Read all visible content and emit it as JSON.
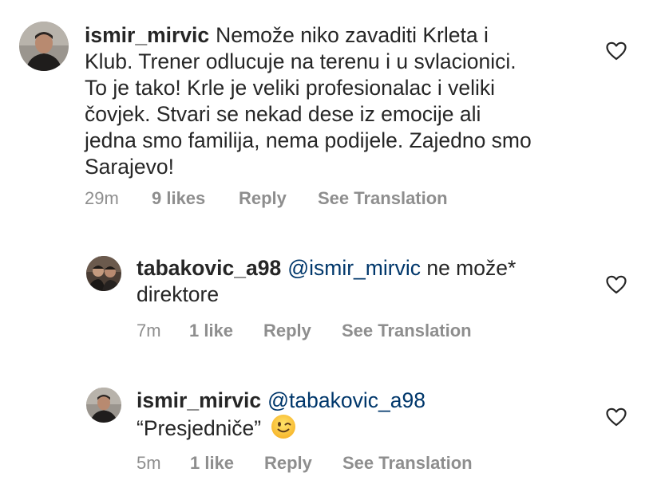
{
  "comments": [
    {
      "username": "ismir_mirvic",
      "text_lines": [
        "Nemože niko zavaditi Krleta i",
        "Klub. Trener odlucuje na terenu i u svlacionici.",
        "To je tako! Krle je veliki profesionalac i veliki",
        "čovjek. Stvari se nekad dese iz emocije ali",
        "jedna smo familija, nema podijele. Zajedno smo",
        "Sarajevo!"
      ],
      "time": "29m",
      "likes": "9 likes",
      "reply": "Reply",
      "translate": "See Translation",
      "avatar": "man-portrait-avatar"
    },
    {
      "username": "tabakovic_a98",
      "mention": "@ismir_mirvic",
      "text_first": "ne može*",
      "text_second": "direktore",
      "time": "7m",
      "likes": "1 like",
      "reply": "Reply",
      "translate": "See Translation",
      "avatar": "two-people-avatar"
    },
    {
      "username": "ismir_mirvic",
      "mention": "@tabakovic_a98",
      "text_second": "“Presjedniče”",
      "emoji": "winking-face-emoji",
      "time": "5m",
      "likes": "1 like",
      "reply": "Reply",
      "translate": "See Translation",
      "avatar": "man-portrait-avatar"
    }
  ],
  "icons": {
    "like": "heart-outline-icon"
  },
  "colors": {
    "text": "#262626",
    "meta": "#8e8e8e",
    "mention": "#00376b"
  }
}
